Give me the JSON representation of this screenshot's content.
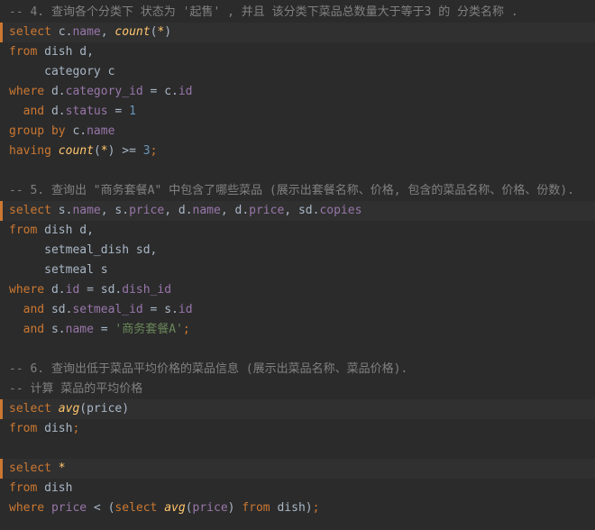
{
  "editor": {
    "language": "sql",
    "colors": {
      "background": "#2b2b2b",
      "keyword": "#cc7832",
      "function": "#ffc66d",
      "column": "#9876aa",
      "number": "#6897bb",
      "string": "#6a8759",
      "comment": "#808080",
      "plain": "#a9b7c6"
    },
    "lines": [
      [
        {
          "t": "cmt",
          "v": "-- 4. 查询各个分类下 状态为 '起售' , 并且 该分类下菜品总数量大于等于3 的 分类名称 ."
        }
      ],
      [
        {
          "t": "kw",
          "v": "select"
        },
        {
          "t": "pl",
          "v": " c."
        },
        {
          "t": "col",
          "v": "name"
        },
        {
          "t": "pl",
          "v": ", "
        },
        {
          "t": "fn",
          "v": "count"
        },
        {
          "t": "pl",
          "v": "("
        },
        {
          "t": "fn",
          "v": "*"
        },
        {
          "t": "pl",
          "v": ")"
        }
      ],
      [
        {
          "t": "kw",
          "v": "from"
        },
        {
          "t": "pl",
          "v": " dish d,"
        }
      ],
      [
        {
          "t": "pl",
          "v": "     category c"
        }
      ],
      [
        {
          "t": "kw",
          "v": "where"
        },
        {
          "t": "pl",
          "v": " d."
        },
        {
          "t": "col",
          "v": "category_id"
        },
        {
          "t": "pl",
          "v": " = c."
        },
        {
          "t": "col",
          "v": "id"
        }
      ],
      [
        {
          "t": "pl",
          "v": "  "
        },
        {
          "t": "kw",
          "v": "and"
        },
        {
          "t": "pl",
          "v": " d."
        },
        {
          "t": "col",
          "v": "status"
        },
        {
          "t": "pl",
          "v": " = "
        },
        {
          "t": "num",
          "v": "1"
        }
      ],
      [
        {
          "t": "kw",
          "v": "group by"
        },
        {
          "t": "pl",
          "v": " c."
        },
        {
          "t": "col",
          "v": "name"
        }
      ],
      [
        {
          "t": "kw",
          "v": "having"
        },
        {
          "t": "pl",
          "v": " "
        },
        {
          "t": "fn",
          "v": "count"
        },
        {
          "t": "pl",
          "v": "("
        },
        {
          "t": "fn",
          "v": "*"
        },
        {
          "t": "pl",
          "v": ") >= "
        },
        {
          "t": "num",
          "v": "3"
        },
        {
          "t": "kw",
          "v": ";"
        }
      ],
      [],
      [
        {
          "t": "cmt",
          "v": "-- 5. 查询出 \"商务套餐A\" 中包含了哪些菜品 (展示出套餐名称、价格, 包含的菜品名称、价格、份数)."
        }
      ],
      [
        {
          "t": "kw",
          "v": "select"
        },
        {
          "t": "pl",
          "v": " s."
        },
        {
          "t": "col",
          "v": "name"
        },
        {
          "t": "pl",
          "v": ", s."
        },
        {
          "t": "col",
          "v": "price"
        },
        {
          "t": "pl",
          "v": ", d."
        },
        {
          "t": "col",
          "v": "name"
        },
        {
          "t": "pl",
          "v": ", d."
        },
        {
          "t": "col",
          "v": "price"
        },
        {
          "t": "pl",
          "v": ", sd."
        },
        {
          "t": "col",
          "v": "copies"
        }
      ],
      [
        {
          "t": "kw",
          "v": "from"
        },
        {
          "t": "pl",
          "v": " dish d,"
        }
      ],
      [
        {
          "t": "pl",
          "v": "     setmeal_dish sd,"
        }
      ],
      [
        {
          "t": "pl",
          "v": "     setmeal s"
        }
      ],
      [
        {
          "t": "kw",
          "v": "where"
        },
        {
          "t": "pl",
          "v": " d."
        },
        {
          "t": "col",
          "v": "id"
        },
        {
          "t": "pl",
          "v": " = sd."
        },
        {
          "t": "col",
          "v": "dish_id"
        }
      ],
      [
        {
          "t": "pl",
          "v": "  "
        },
        {
          "t": "kw",
          "v": "and"
        },
        {
          "t": "pl",
          "v": " sd."
        },
        {
          "t": "col",
          "v": "setmeal_id"
        },
        {
          "t": "pl",
          "v": " = s."
        },
        {
          "t": "col",
          "v": "id"
        }
      ],
      [
        {
          "t": "pl",
          "v": "  "
        },
        {
          "t": "kw",
          "v": "and"
        },
        {
          "t": "pl",
          "v": " s."
        },
        {
          "t": "col",
          "v": "name"
        },
        {
          "t": "pl",
          "v": " = "
        },
        {
          "t": "str",
          "v": "'商务套餐A'"
        },
        {
          "t": "kw",
          "v": ";"
        }
      ],
      [],
      [
        {
          "t": "cmt",
          "v": "-- 6. 查询出低于菜品平均价格的菜品信息 (展示出菜品名称、菜品价格)."
        }
      ],
      [
        {
          "t": "cmt",
          "v": "-- 计算 菜品的平均价格"
        }
      ],
      [
        {
          "t": "kw",
          "v": "select"
        },
        {
          "t": "pl",
          "v": " "
        },
        {
          "t": "fn",
          "v": "avg"
        },
        {
          "t": "pl",
          "v": "(price)"
        }
      ],
      [
        {
          "t": "kw",
          "v": "from"
        },
        {
          "t": "pl",
          "v": " dish"
        },
        {
          "t": "kw",
          "v": ";"
        }
      ],
      [],
      [
        {
          "t": "kw",
          "v": "select"
        },
        {
          "t": "pl",
          "v": " "
        },
        {
          "t": "fn",
          "v": "*"
        }
      ],
      [
        {
          "t": "kw",
          "v": "from"
        },
        {
          "t": "pl",
          "v": " dish"
        }
      ],
      [
        {
          "t": "kw",
          "v": "where"
        },
        {
          "t": "pl",
          "v": " "
        },
        {
          "t": "col",
          "v": "price"
        },
        {
          "t": "pl",
          "v": " < ("
        },
        {
          "t": "kw",
          "v": "select"
        },
        {
          "t": "pl",
          "v": " "
        },
        {
          "t": "fn",
          "v": "avg"
        },
        {
          "t": "pl",
          "v": "("
        },
        {
          "t": "col",
          "v": "price"
        },
        {
          "t": "pl",
          "v": ") "
        },
        {
          "t": "kw",
          "v": "from"
        },
        {
          "t": "pl",
          "v": " dish)"
        },
        {
          "t": "kw",
          "v": ";"
        }
      ]
    ]
  }
}
